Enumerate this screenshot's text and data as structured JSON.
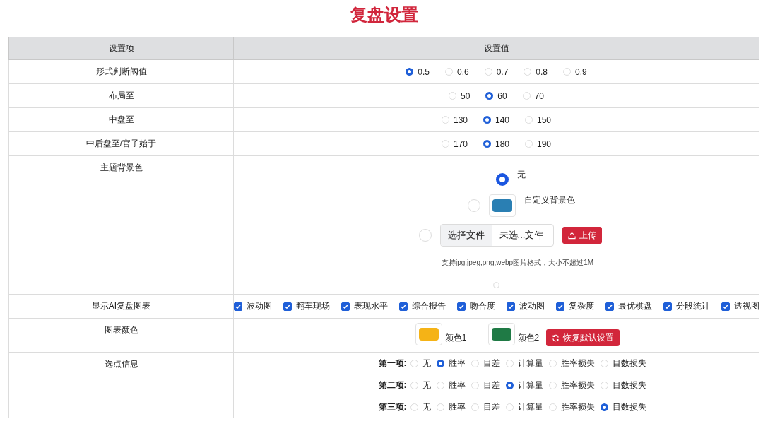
{
  "title": "复盘设置",
  "columns": [
    "设置项",
    "设置值"
  ],
  "radio_rows": [
    {
      "label": "形式判断阈值",
      "options": [
        {
          "label": "0.5",
          "selected": true
        },
        {
          "label": "0.6",
          "selected": false
        },
        {
          "label": "0.7",
          "selected": false
        },
        {
          "label": "0.8",
          "selected": false
        },
        {
          "label": "0.9",
          "selected": false
        }
      ]
    },
    {
      "label": "布局至",
      "options": [
        {
          "label": "50",
          "selected": false
        },
        {
          "label": "60",
          "selected": true
        },
        {
          "label": "70",
          "selected": false
        }
      ]
    },
    {
      "label": "中盘至",
      "options": [
        {
          "label": "130",
          "selected": false
        },
        {
          "label": "140",
          "selected": true
        },
        {
          "label": "150",
          "selected": false
        }
      ]
    },
    {
      "label": "中后盘至/官子始于",
      "options": [
        {
          "label": "170",
          "selected": false
        },
        {
          "label": "180",
          "selected": true
        },
        {
          "label": "190",
          "selected": false
        }
      ]
    }
  ],
  "theme": {
    "label": "主题背景色",
    "none": {
      "label": "无",
      "selected": true
    },
    "custom": {
      "label": "自定义背景色",
      "selected": false,
      "color": "#2a7fb3"
    },
    "file": {
      "selected": false,
      "choose_button": "选择文件",
      "file_name": "未选...文件",
      "upload_button": "上传",
      "hint": "支持jpg,jpeg,png,webp图片格式，大小不超过1M"
    }
  },
  "charts": {
    "label": "显示AI复盘图表",
    "items": [
      {
        "label": "波动图",
        "checked": true
      },
      {
        "label": "翻车现场",
        "checked": true
      },
      {
        "label": "表现水平",
        "checked": true
      },
      {
        "label": "综合报告",
        "checked": true
      },
      {
        "label": "吻合度",
        "checked": true
      },
      {
        "label": "波动图",
        "checked": true
      },
      {
        "label": "复杂度",
        "checked": true
      },
      {
        "label": "最优棋盘",
        "checked": true
      },
      {
        "label": "分段统计",
        "checked": true
      },
      {
        "label": "透视图",
        "checked": true
      }
    ]
  },
  "chart_colors": {
    "label": "图表颜色",
    "colors": [
      {
        "label": "颜色1",
        "color": "#f5b316"
      },
      {
        "label": "颜色2",
        "color": "#1f7a45"
      }
    ],
    "reset_button": "恢复默认设置"
  },
  "points": {
    "label": "选点信息",
    "items": [
      {
        "label": "第一项:",
        "options": [
          {
            "label": "无",
            "selected": false
          },
          {
            "label": "胜率",
            "selected": true
          },
          {
            "label": "目差",
            "selected": false
          },
          {
            "label": "计算量",
            "selected": false
          },
          {
            "label": "胜率损失",
            "selected": false
          },
          {
            "label": "目数损失",
            "selected": false
          }
        ]
      },
      {
        "label": "第二项:",
        "options": [
          {
            "label": "无",
            "selected": false
          },
          {
            "label": "胜率",
            "selected": false
          },
          {
            "label": "目差",
            "selected": false
          },
          {
            "label": "计算量",
            "selected": true
          },
          {
            "label": "胜率损失",
            "selected": false
          },
          {
            "label": "目数损失",
            "selected": false
          }
        ]
      },
      {
        "label": "第三项:",
        "options": [
          {
            "label": "无",
            "selected": false
          },
          {
            "label": "胜率",
            "selected": false
          },
          {
            "label": "目差",
            "selected": false
          },
          {
            "label": "计算量",
            "selected": false
          },
          {
            "label": "胜率损失",
            "selected": false
          },
          {
            "label": "目数损失",
            "selected": true
          }
        ]
      }
    ]
  }
}
